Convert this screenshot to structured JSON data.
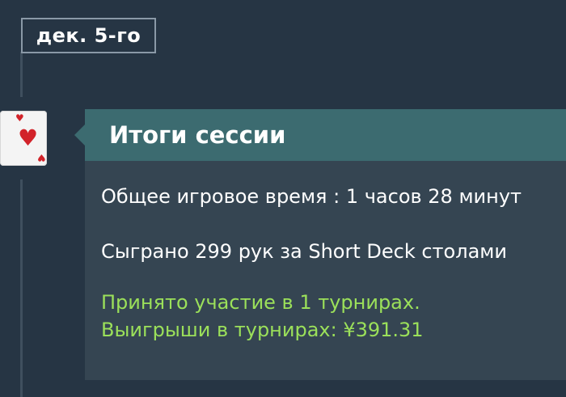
{
  "date_badge": {
    "label": "дек. 5-го"
  },
  "card_icon": {
    "suit": "hearts",
    "pip": "♥",
    "color": "#d2232a"
  },
  "session_summary": {
    "title": "Итоги сессии",
    "play_time": "Общее игровое время : 1 часов 28 минут",
    "hands_played": "Сыграно 299 рук за Short Deck столами",
    "tournaments_entered": "Принято участие в 1 турнирах.",
    "tournament_winnings": "Выигрыши в турнирах: ¥391.31"
  },
  "colors": {
    "background": "#263544",
    "header": "#3c6b70",
    "panel": "#354552",
    "highlight_text": "#9be05a"
  }
}
